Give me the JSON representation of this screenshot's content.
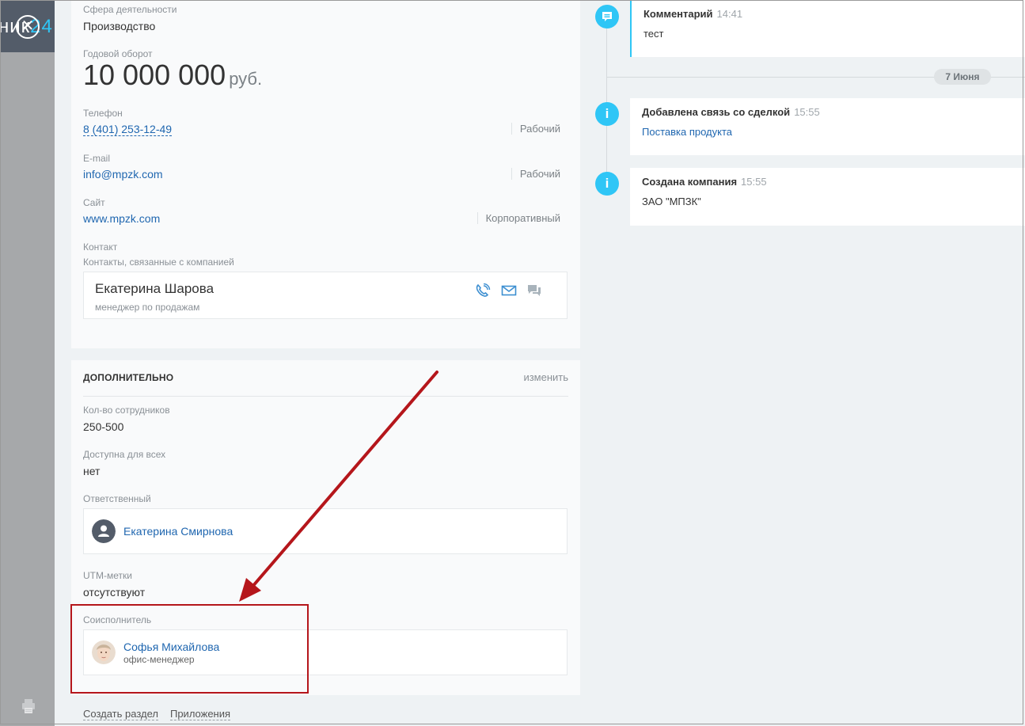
{
  "background": {
    "logo_left": "ник",
    "logo_right": "24"
  },
  "company": {
    "industry_label": "Сфера деятельности",
    "industry": "Производство",
    "revenue_label": "Годовой оборот",
    "revenue": "10 000 000",
    "revenue_unit": "руб.",
    "phone_label": "Телефон",
    "phone": "8 (401) 253-12-49",
    "phone_type": "Рабочий",
    "email_label": "E-mail",
    "email": "info@mpzk.com",
    "email_type": "Рабочий",
    "site_label": "Сайт",
    "site": "www.mpzk.com",
    "site_type": "Корпоративный",
    "contact_label": "Контакт",
    "contact_sublabel": "Контакты, связанные с компанией",
    "contact": {
      "name": "Екатерина Шарова",
      "role": "менеджер по продажам"
    }
  },
  "extra": {
    "title": "ДОПОЛНИТЕЛЬНО",
    "edit": "изменить",
    "employees_label": "Кол-во сотрудников",
    "employees": "250-500",
    "public_label": "Доступна для всех",
    "public": "нет",
    "responsible_label": "Ответственный",
    "responsible": "Екатерина Смирнова",
    "utm_label": "UTM-метки",
    "utm": "отсутствуют",
    "coexec_label": "Соисполнитель",
    "coexec": {
      "name": "Софья Михайлова",
      "role": "офис-менеджер"
    }
  },
  "bottom": {
    "create_section": "Создать раздел",
    "apps": "Приложения"
  },
  "timeline": {
    "date": "7 Июня",
    "items": [
      {
        "title": "Комментарий",
        "time": "14:41",
        "text": "тест"
      },
      {
        "title": "Добавлена связь со сделкой",
        "time": "15:55",
        "text": "Поставка продукта"
      },
      {
        "title": "Создана компания",
        "time": "15:55",
        "text": "ЗАО \"МПЗК\""
      }
    ]
  },
  "colors": {
    "accent": "#2fc6f6",
    "link": "#2067b0",
    "highlight": "#b5161b"
  }
}
